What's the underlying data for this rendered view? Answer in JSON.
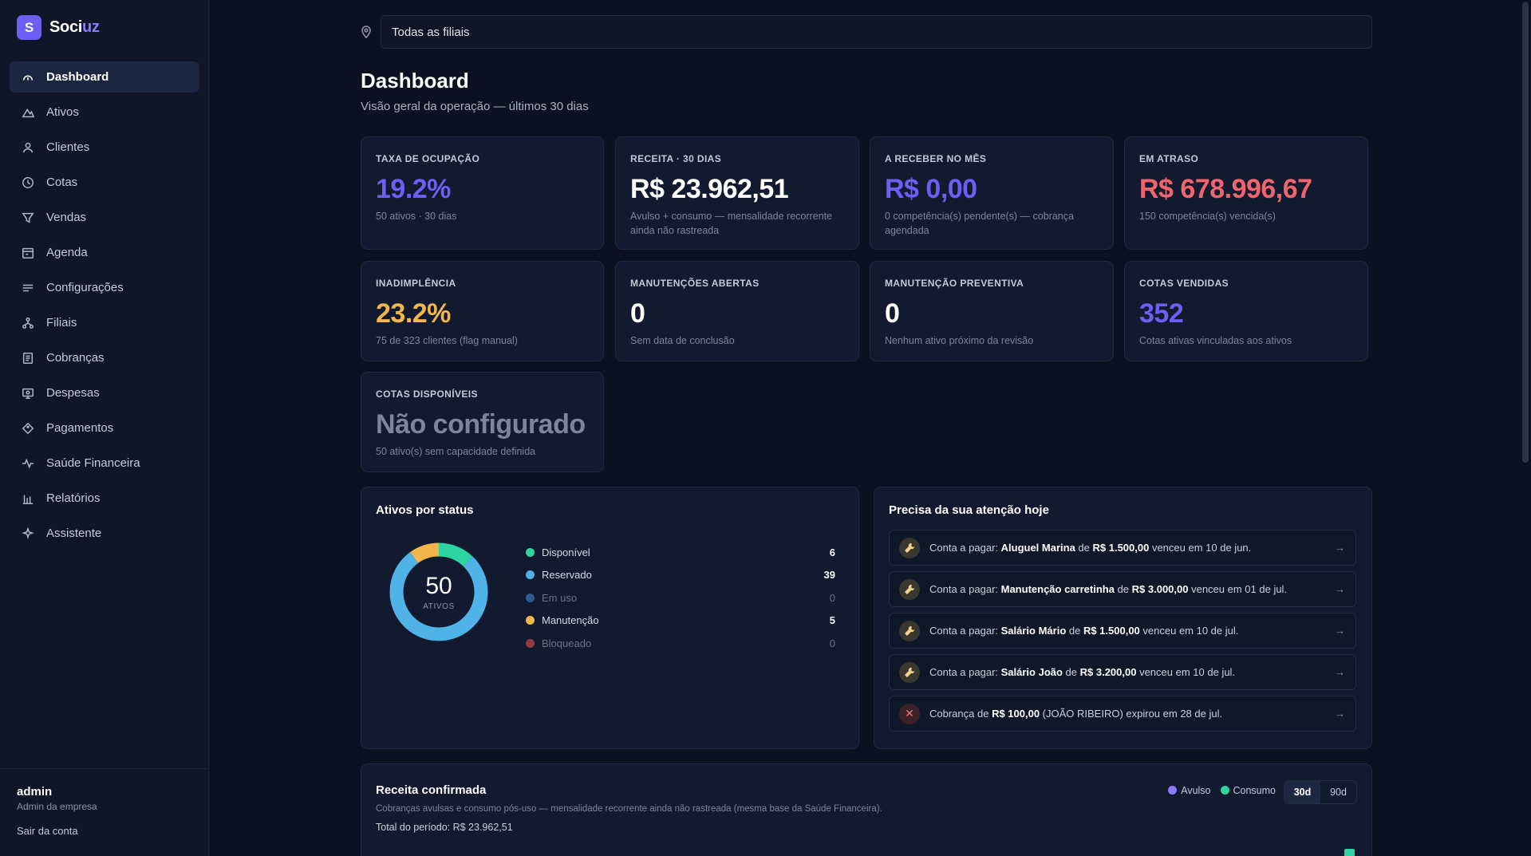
{
  "brand": {
    "name_main": "Soci",
    "name_accent": "uz",
    "logo_glyph": "S",
    "logo_color": "#6d5ef6"
  },
  "sidebar": {
    "items": [
      {
        "label": "Dashboard",
        "icon": "gauge-icon",
        "active": true
      },
      {
        "label": "Ativos",
        "icon": "mountain-icon"
      },
      {
        "label": "Clientes",
        "icon": "user-icon"
      },
      {
        "label": "Cotas",
        "icon": "clock-icon"
      },
      {
        "label": "Vendas",
        "icon": "filter-icon"
      },
      {
        "label": "Agenda",
        "icon": "calendar-icon"
      },
      {
        "label": "Configurações",
        "icon": "list-icon"
      },
      {
        "label": "Filiais",
        "icon": "network-icon"
      },
      {
        "label": "Cobranças",
        "icon": "receipt-icon"
      },
      {
        "label": "Despesas",
        "icon": "monitor-icon"
      },
      {
        "label": "Pagamentos",
        "icon": "diamond-icon"
      },
      {
        "label": "Saúde Financeira",
        "icon": "pulse-icon"
      },
      {
        "label": "Relatórios",
        "icon": "bar-chart-icon"
      },
      {
        "label": "Assistente",
        "icon": "sparkles-icon"
      }
    ],
    "footer": {
      "user": "admin",
      "role": "Admin da empresa",
      "logout": "Sair da conta"
    }
  },
  "filter": {
    "value": "Todas as filiais",
    "icon": "map-pin-icon"
  },
  "page": {
    "title": "Dashboard",
    "subtitle": "Visão geral da operação — últimos 30 dias"
  },
  "kpis": [
    {
      "label": "TAXA DE OCUPAÇÃO",
      "value": "19.2%",
      "desc": "50 ativos · 30 dias",
      "color": "#6d5ef6"
    },
    {
      "label": "RECEITA · 30 DIAS",
      "value": "R$ 23.962,51",
      "desc": "Avulso + consumo — mensalidade recorrente ainda não rastreada",
      "color": "#ffffff"
    },
    {
      "label": "A RECEBER NO MÊS",
      "value": "R$ 0,00",
      "desc": "0 competência(s) pendente(s) — cobrança agendada",
      "color": "#6d5ef6"
    },
    {
      "label": "EM ATRASO",
      "value": "R$ 678.996,67",
      "desc": "150 competência(s) vencida(s)",
      "color": "#f0656d"
    },
    {
      "label": "INADIMPLÊNCIA",
      "value": "23.2%",
      "desc": "75 de 323 clientes (flag manual)",
      "color": "#f2b64a"
    },
    {
      "label": "MANUTENÇÕES ABERTAS",
      "value": "0",
      "desc": "Sem data de conclusão",
      "color": "#ffffff"
    },
    {
      "label": "MANUTENÇÃO PREVENTIVA",
      "value": "0",
      "desc": "Nenhum ativo próximo da revisão",
      "color": "#ffffff"
    },
    {
      "label": "COTAS VENDIDAS",
      "value": "352",
      "desc": "Cotas ativas vinculadas aos ativos",
      "color": "#6d5ef6"
    },
    {
      "label": "COTAS DISPONÍVEIS",
      "value": "Não configurado",
      "desc": "50 ativo(s) sem capacidade definida",
      "color": "#7c8699"
    }
  ],
  "status_card": {
    "title": "Ativos por status",
    "total": "50",
    "total_label": "ATIVOS",
    "items": [
      {
        "label": "Disponível",
        "value": 6,
        "color": "#2dd4a0"
      },
      {
        "label": "Reservado",
        "value": 39,
        "color": "#4fb3e8"
      },
      {
        "label": "Em uso",
        "value": 0,
        "color": "#2f5c8f"
      },
      {
        "label": "Manutenção",
        "value": 5,
        "color": "#f2b64a"
      },
      {
        "label": "Bloqueado",
        "value": 0,
        "color": "#8f3a42"
      }
    ]
  },
  "attention": {
    "title": "Precisa da sua atenção hoje",
    "items": [
      {
        "type": "warn",
        "pre": "Conta a pagar: ",
        "name": "Aluguel Marina",
        "mid": " de ",
        "amount": "R$ 1.500,00",
        "post": " venceu em 10 de jun."
      },
      {
        "type": "warn",
        "pre": "Conta a pagar: ",
        "name": "Manutenção carretinha",
        "mid": " de ",
        "amount": "R$ 3.000,00",
        "post": " venceu em 01 de jul."
      },
      {
        "type": "warn",
        "pre": "Conta a pagar: ",
        "name": "Salário Mário",
        "mid": " de ",
        "amount": "R$ 1.500,00",
        "post": " venceu em 10 de jul."
      },
      {
        "type": "warn",
        "pre": "Conta a pagar: ",
        "name": "Salário João",
        "mid": " de ",
        "amount": "R$ 3.200,00",
        "post": " venceu em 10 de jul."
      },
      {
        "type": "err",
        "pre": "Cobrança de ",
        "name": "R$ 100,00",
        "mid": " (JOÃO RIBEIRO) expirou em 28 de jul.",
        "amount": "",
        "post": ""
      }
    ],
    "arrow": "→"
  },
  "revenue": {
    "title": "Receita confirmada",
    "subtitle": "Cobranças avulsas e consumo pós-uso — mensalidade recorrente ainda não rastreada (mesma base da Saúde Financeira).",
    "total": "Total do período: R$ 23.962,51",
    "legend": [
      {
        "label": "Avulso",
        "color": "#8b7cff"
      },
      {
        "label": "Consumo",
        "color": "#2dd4a0"
      }
    ],
    "ranges": [
      {
        "label": "30d",
        "active": true
      },
      {
        "label": "90d",
        "active": false
      }
    ]
  }
}
